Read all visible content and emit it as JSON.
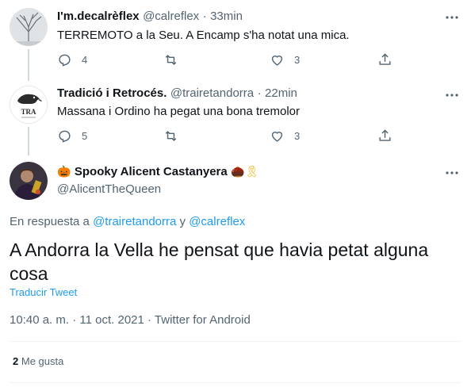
{
  "colors": {
    "accent": "#1d9bf0",
    "muted": "#536471",
    "text": "#0f1419",
    "line": "#cfd9de"
  },
  "replies": [
    {
      "name": "I'm.decalrèflex",
      "handle": "@calreflex",
      "sep": "·",
      "time": "33min",
      "text": "TERREMOTO a la Seu. A Encamp s'ha notat una mica.",
      "reply_count": "4",
      "like_count": "3"
    },
    {
      "name": "Tradició i Retrocés.",
      "handle": "@trairetandorra",
      "sep": "·",
      "time": "22min",
      "text": "Massana i Ordino ha pegat una bona tremolor",
      "reply_count": "5",
      "like_count": "3",
      "avatar_text": "TRA"
    }
  ],
  "main": {
    "emoji_pumpkin": "🎃",
    "name": "Spooky Alicent Castanyera",
    "emoji_chestnut": "🌰",
    "emoji_ribbon": "🎗",
    "handle": "@AlicentTheQueen",
    "reply_prefix": "En respuesta a",
    "reply_to_1": "@trairetandorra",
    "reply_and": "y",
    "reply_to_2": "@calreflex",
    "text": "A Andorra la Vella he pensat que havia petat alguna cosa",
    "translate": "Traducir Tweet",
    "time": "10:40 a. m.",
    "dot1": "·",
    "date": "11 oct. 2021",
    "dot2": "·",
    "source": "Twitter for Android",
    "likes_count": "2",
    "likes_label": "Me gusta"
  },
  "icons": [
    "reply-icon",
    "retweet-icon",
    "like-icon",
    "share-icon",
    "more-icon"
  ]
}
